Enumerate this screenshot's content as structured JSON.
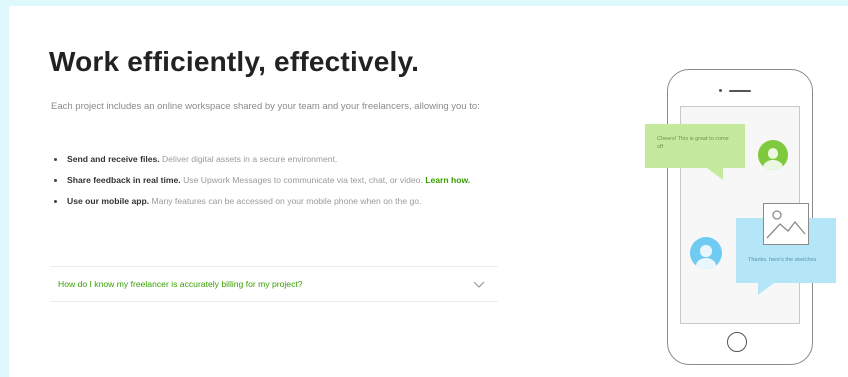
{
  "title": "Work efficiently, effectively.",
  "intro": "Each project includes an online workspace shared by your team and your freelancers, allowing you to:",
  "bullets": [
    {
      "bold": "Send and receive files.",
      "text": " Deliver digital assets in a secure environment."
    },
    {
      "bold": "Share feedback in real time.",
      "text": " Use Upwork Messages to communicate via text, chat, or video. ",
      "link": "Learn how."
    },
    {
      "bold": "Use our mobile app.",
      "text": " Many features can be accessed on your mobile phone when on the go."
    }
  ],
  "faq": {
    "question": "How do I know my freelancer is accurately billing for my project?",
    "icon": "chevron-down-icon"
  },
  "illustration": {
    "green_bubble_text": "Cheers! This is great to come off",
    "blue_bubble_text": "Thanks, here's the sketches",
    "colors": {
      "green": "#c5ea9d",
      "blue": "#b5e6f7",
      "avatar_green": "#7ec93d",
      "avatar_blue": "#6fcbf2"
    },
    "icons": [
      "image-icon",
      "user-avatar-icon"
    ]
  },
  "colors": {
    "accent": "#37a000",
    "background": "#dff8fc"
  }
}
